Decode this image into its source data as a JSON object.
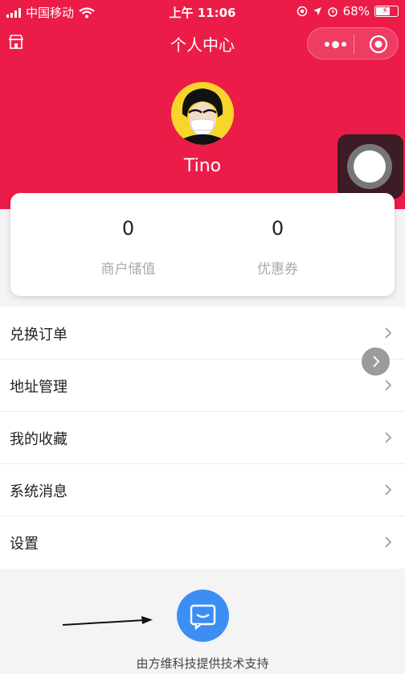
{
  "status_bar": {
    "carrier": "中国移动",
    "time": "上午 11:06",
    "battery": "68%",
    "battery_level": 0.68
  },
  "nav": {
    "title": "个人中心",
    "icons": [
      "store-icon",
      "more-dots-icon",
      "close-target-icon"
    ]
  },
  "profile": {
    "username": "Tino"
  },
  "stats": [
    {
      "value": "0",
      "label": "商户储值"
    },
    {
      "value": "0",
      "label": "优惠券"
    }
  ],
  "menu": [
    {
      "label": "兑换订单"
    },
    {
      "label": "地址管理"
    },
    {
      "label": "我的收藏"
    },
    {
      "label": "系统消息"
    },
    {
      "label": "设置"
    }
  ],
  "footer": {
    "text": "由方维科技提供技术支持",
    "icon": "chat-icon"
  },
  "colors": {
    "header": "#ec1c49",
    "chat_button": "#3d8ef3"
  }
}
